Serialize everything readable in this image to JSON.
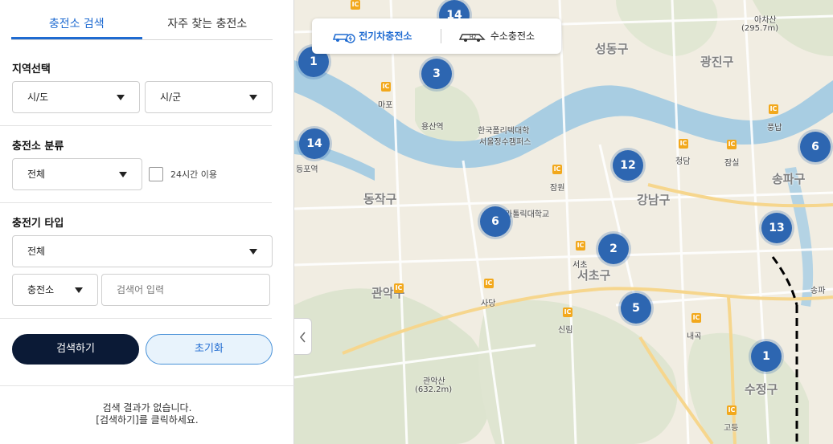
{
  "tabs": [
    {
      "label": "충전소 검색",
      "active": true
    },
    {
      "label": "자주 찾는 충전소",
      "active": false
    }
  ],
  "region": {
    "title": "지역선택",
    "sido": "시/도",
    "sigungu": "시/군"
  },
  "category": {
    "title": "충전소 분류",
    "value": "전체",
    "checkbox_label": "24시간 이용",
    "checked": false
  },
  "charger_type": {
    "title": "충전기 타입",
    "value": "전체",
    "search_target": "충전소",
    "search_placeholder": "검색어 입력"
  },
  "buttons": {
    "search": "검색하기",
    "reset": "초기화"
  },
  "result": {
    "line1": "검색 결과가 없습니다.",
    "line2": "[검색하기]를 클릭하세요."
  },
  "map_toggle": {
    "ev": "전기차충전소",
    "h2": "수소충전소"
  },
  "map": {
    "district_labels": [
      "성동구",
      "광진구",
      "동작구",
      "강남구",
      "송파구",
      "서초구",
      "관악구",
      "수정구"
    ],
    "place_labels": [
      "마포",
      "용산역",
      "한국폴리텍대학",
      "서울정수캠퍼스",
      "청담",
      "잠실",
      "잠원",
      "가톨릭대학교",
      "서초",
      "사당",
      "신림",
      "관악산",
      "(632.2m)",
      "풍납",
      "아차산",
      "(295.7m)",
      "등포역",
      "고등",
      "내곡",
      "송파"
    ],
    "clusters": [
      "14",
      "3",
      "1",
      "14",
      "12",
      "6",
      "6",
      "2",
      "13",
      "5",
      "1"
    ]
  }
}
